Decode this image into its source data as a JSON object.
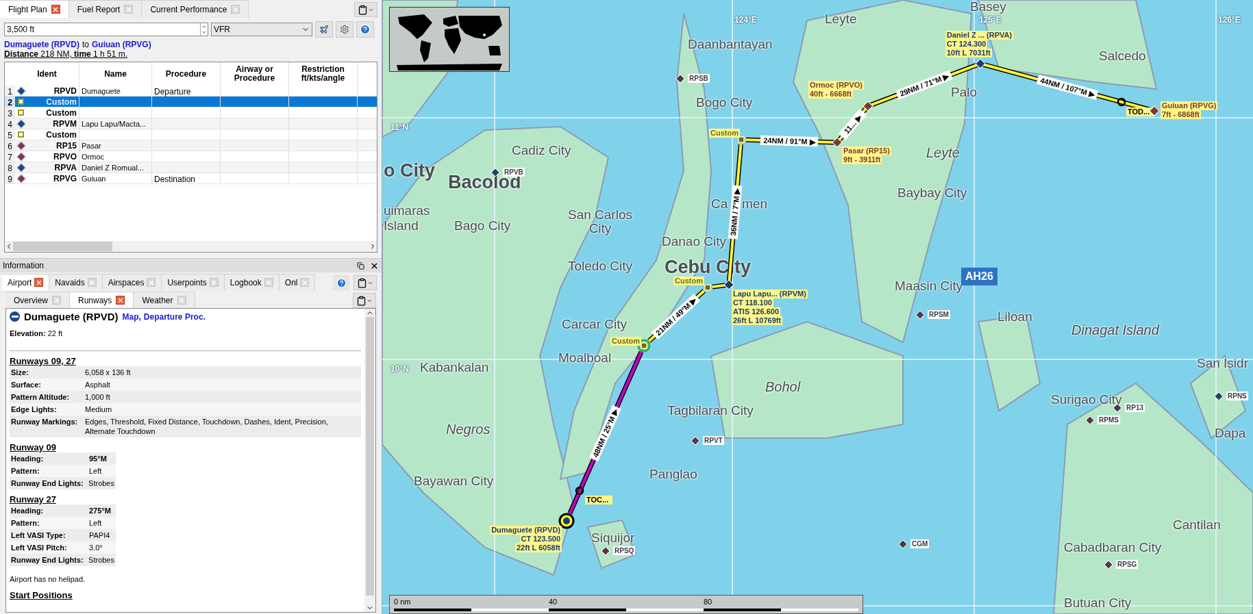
{
  "flight_plan_panel": {
    "tabs": [
      {
        "label": "Flight Plan",
        "selected": true
      },
      {
        "label": "Fuel Report",
        "selected": false
      },
      {
        "label": "Current Performance",
        "selected": false
      }
    ],
    "altitude": "3,500 ft",
    "flight_rules": "VFR",
    "route_title": {
      "from": "Dumaguete (RPVD)",
      "connector": "to",
      "to": "Guiuan (RPVG)"
    },
    "summary": "**Distance** 218 NM, **time** 1 h 51 m.",
    "table": {
      "columns": [
        "Ident",
        "Name",
        "Procedure",
        "Airway or Procedure",
        "Restriction ft/kts/angle"
      ],
      "rows": [
        {
          "number": "1",
          "kind": "airport",
          "color": "#1b4a8a",
          "ident": "RPVD",
          "name": "Dumaguete",
          "procedure": "Departure",
          "selected": false
        },
        {
          "number": "2",
          "kind": "userpoint",
          "color": "#9a9a1a",
          "ident": "Custom",
          "selected": true
        },
        {
          "number": "3",
          "kind": "userpoint",
          "color": "#9a9a1a",
          "ident": "Custom",
          "selected": false
        },
        {
          "number": "4",
          "kind": "airport",
          "color": "#1b4a8a",
          "ident": "RPVM",
          "name": "Lapu Lapu/Macta...",
          "selected": false
        },
        {
          "number": "5",
          "kind": "userpoint",
          "color": "#9a9a1a",
          "ident": "Custom",
          "selected": false
        },
        {
          "number": "6",
          "kind": "airport",
          "color": "#7a3a5a",
          "ident": "RP15",
          "name": "Pasar",
          "selected": false
        },
        {
          "number": "7",
          "kind": "airport",
          "color": "#7a3a5a",
          "ident": "RPVO",
          "name": "Ormoc",
          "selected": false
        },
        {
          "number": "8",
          "kind": "airport",
          "color": "#1b4a8a",
          "ident": "RPVA",
          "name": "Daniel Z Romual...",
          "selected": false
        },
        {
          "number": "9",
          "kind": "airport",
          "color": "#7a3a5a",
          "ident": "RPVG",
          "name": "Guiuan",
          "procedure": "Destination",
          "selected": false
        }
      ]
    }
  },
  "information_panel": {
    "title": "Information",
    "tabs": [
      {
        "label": "Airport",
        "selected": true
      },
      {
        "label": "Navaids",
        "selected": false
      },
      {
        "label": "Airspaces",
        "selected": false
      },
      {
        "label": "Userpoints",
        "selected": false
      },
      {
        "label": "Logbook",
        "selected": false
      },
      {
        "label": "Onl",
        "selected": false
      }
    ],
    "subtabs": [
      {
        "label": "Overview",
        "selected": false
      },
      {
        "label": "Runways",
        "selected": true
      },
      {
        "label": "Weather",
        "selected": false
      }
    ],
    "airport": {
      "name": "Dumaguete (RPVD)",
      "links": [
        "Map",
        "Departure Proc."
      ],
      "link_separator": ",",
      "elevation": "**Elevation:** 22 ft"
    },
    "sections": [
      {
        "heading": "Runways 09, 27",
        "kind": "wide",
        "rows": [
          {
            "label": "Size:",
            "value": "6,058 x 136 ft",
            "bold": false
          },
          {
            "label": "Surface:",
            "value": "Asphalt",
            "bold": false
          },
          {
            "label": "Pattern Altitude:",
            "value": "1,000 ft",
            "bold": false
          },
          {
            "label": "Edge Lights:",
            "value": "Medium",
            "bold": false
          },
          {
            "label": "Runway Markings:",
            "value": "Edges, Threshold, Fixed Distance, Touchdown, Dashes, Ident, Precision, Alternate Touchdown",
            "bold": false
          }
        ]
      },
      {
        "heading": "Runway 09",
        "kind": "narrow",
        "rows": [
          {
            "label": "Heading:",
            "value": "95°M",
            "bold": true
          },
          {
            "label": "Pattern:",
            "value": "Left",
            "bold": false
          },
          {
            "label": "Runway End Lights:",
            "value": "Strobes",
            "bold": false
          }
        ]
      },
      {
        "heading": "Runway 27",
        "kind": "narrow",
        "rows": [
          {
            "label": "Heading:",
            "value": "275°M",
            "bold": true
          },
          {
            "label": "Pattern:",
            "value": "Left",
            "bold": false
          },
          {
            "label": "Left VASI Type:",
            "value": "PAPI4",
            "bold": false
          },
          {
            "label": "Left VASI Pitch:",
            "value": "3.0°",
            "bold": false
          },
          {
            "label": "Runway End Lights:",
            "value": "Strobes",
            "bold": false
          }
        ]
      }
    ],
    "note": "Airport has no helipad.",
    "next_heading": "Start Positions"
  },
  "map": {
    "grid_labels": [
      "124°E",
      "125°E",
      "126°E",
      "11°N",
      "10°N"
    ],
    "places": [
      {
        "name": "Basey",
        "kind": "city"
      },
      {
        "name": "Leyte",
        "kind": "city"
      },
      {
        "name": "Daanbantayan",
        "kind": "city"
      },
      {
        "name": "Bogo City",
        "kind": "city"
      },
      {
        "name": "Salcedo",
        "kind": "city"
      },
      {
        "name": "Palo",
        "kind": "city"
      },
      {
        "name": "Leyte",
        "kind": "region"
      },
      {
        "name": "Cadiz City",
        "kind": "city"
      },
      {
        "name": "o City",
        "kind": "major"
      },
      {
        "name": "Bacolod",
        "kind": "major"
      },
      {
        "name": "uimaras",
        "kind": "city"
      },
      {
        "name": "Island",
        "kind": "city"
      },
      {
        "name": "Bago City",
        "kind": "city"
      },
      {
        "name": "San Carlos City",
        "kind": "city"
      },
      {
        "name": "Ca",
        "kind": "city"
      },
      {
        "name": "men",
        "kind": "city"
      },
      {
        "name": "Baybay City",
        "kind": "city"
      },
      {
        "name": "Danao City",
        "kind": "city"
      },
      {
        "name": "Toledo City",
        "kind": "city"
      },
      {
        "name": "Cebu City",
        "kind": "major"
      },
      {
        "name": "Maasin City",
        "kind": "city"
      },
      {
        "name": "Liloan",
        "kind": "city"
      },
      {
        "name": "Dinagat Island",
        "kind": "region"
      },
      {
        "name": "Carcar City",
        "kind": "city"
      },
      {
        "name": "Moalboal",
        "kind": "city"
      },
      {
        "name": "San Isidr",
        "kind": "city"
      },
      {
        "name": "Kabankalan",
        "kind": "city"
      },
      {
        "name": "Bohol",
        "kind": "region"
      },
      {
        "name": "Surigao City",
        "kind": "city"
      },
      {
        "name": "Tagbilaran City",
        "kind": "city"
      },
      {
        "name": "Negros",
        "kind": "region"
      },
      {
        "name": "Dapa",
        "kind": "city"
      },
      {
        "name": "Panglao",
        "kind": "city"
      },
      {
        "name": "Bayawan City",
        "kind": "city"
      },
      {
        "name": "Cantilan",
        "kind": "city"
      },
      {
        "name": "Siquijor",
        "kind": "city"
      },
      {
        "name": "Cabadbaran City",
        "kind": "city"
      },
      {
        "name": "Butuan City",
        "kind": "city"
      }
    ],
    "airports": [
      {
        "ident": "RPSB",
        "color": "#4a3a44"
      },
      {
        "ident": "RPVB",
        "color": "#24455e"
      },
      {
        "ident": "RPSM",
        "color": "#5a3848"
      },
      {
        "ident": "RPVT",
        "color": "#5a3848"
      },
      {
        "ident": "RPSQ",
        "color": "#5a3848"
      },
      {
        "ident": "CGM",
        "color": "#4a3a44"
      },
      {
        "ident": "RPSG",
        "color": "#5a3848"
      },
      {
        "ident": "RPMS",
        "color": "#5a3848"
      },
      {
        "ident": "RP13",
        "color": "#4a3a44"
      },
      {
        "ident": "RPNS",
        "color": "#24455e"
      }
    ],
    "road_sign": "AH26",
    "route": {
      "legs": [
        {
          "label": "48NM / 25°M ▶",
          "active": true
        },
        {
          "label": "21NM / 49°M ▶",
          "active": false
        },
        {
          "active": false
        },
        {
          "label": "36NM / 7°M ▶",
          "active": false
        },
        {
          "label": "24NM / 91°M ▶",
          "active": false
        },
        {
          "label": "11... ▶",
          "active": false
        },
        {
          "label": "29NM / 71°M ▶",
          "active": false
        },
        {
          "label": "44NM / 107°M ▶",
          "active": false
        }
      ],
      "waypoints": [
        {
          "kind": "departure",
          "color": "#1a3d6e",
          "selected": false,
          "callout": [
            "Dumaguete (RPVD)",
            "CT 123.500",
            "22ft L 6058ft"
          ]
        },
        {
          "kind": "userpoint",
          "color": "#6b6b1a",
          "selected": true,
          "callout": [
            "Custom"
          ]
        },
        {
          "kind": "userpoint",
          "color": "#6b6b1a",
          "selected": false,
          "callout": [
            "Custom"
          ]
        },
        {
          "kind": "airport",
          "color": "#1a3d6e",
          "selected": false,
          "callout": [
            "Lapu Lapu... (RPVM)",
            "CT 118.100",
            "ATIS 126.600",
            "26ft L 10769ft"
          ]
        },
        {
          "kind": "userpoint",
          "color": "#6b6b1a",
          "selected": false,
          "callout": [
            "Custom"
          ]
        },
        {
          "kind": "airport",
          "color": "#7a3d2a",
          "selected": false,
          "callout": [
            "Pasar (RP15)",
            "9ft - 3911ft"
          ]
        },
        {
          "kind": "airport",
          "color": "#7a3d2a",
          "selected": false,
          "callout": [
            "Ormoc (RPVO)",
            "40ft - 6668ft"
          ]
        },
        {
          "kind": "airport",
          "color": "#1a3d6e",
          "selected": false,
          "callout": [
            "Daniel Z ... (RPVA)",
            "CT 124.300",
            "10ft L 7031ft"
          ]
        },
        {
          "kind": "airport",
          "color": "#7a3d2a",
          "selected": false,
          "callout": [
            "Guiuan (RPVG)",
            "7ft - 6868ft"
          ]
        }
      ],
      "profile_markers": [
        {
          "label": "TOC..."
        },
        {
          "label": "TOD..."
        }
      ]
    },
    "scale": {
      "labels": [
        "0 nm",
        "40",
        "80"
      ]
    }
  }
}
